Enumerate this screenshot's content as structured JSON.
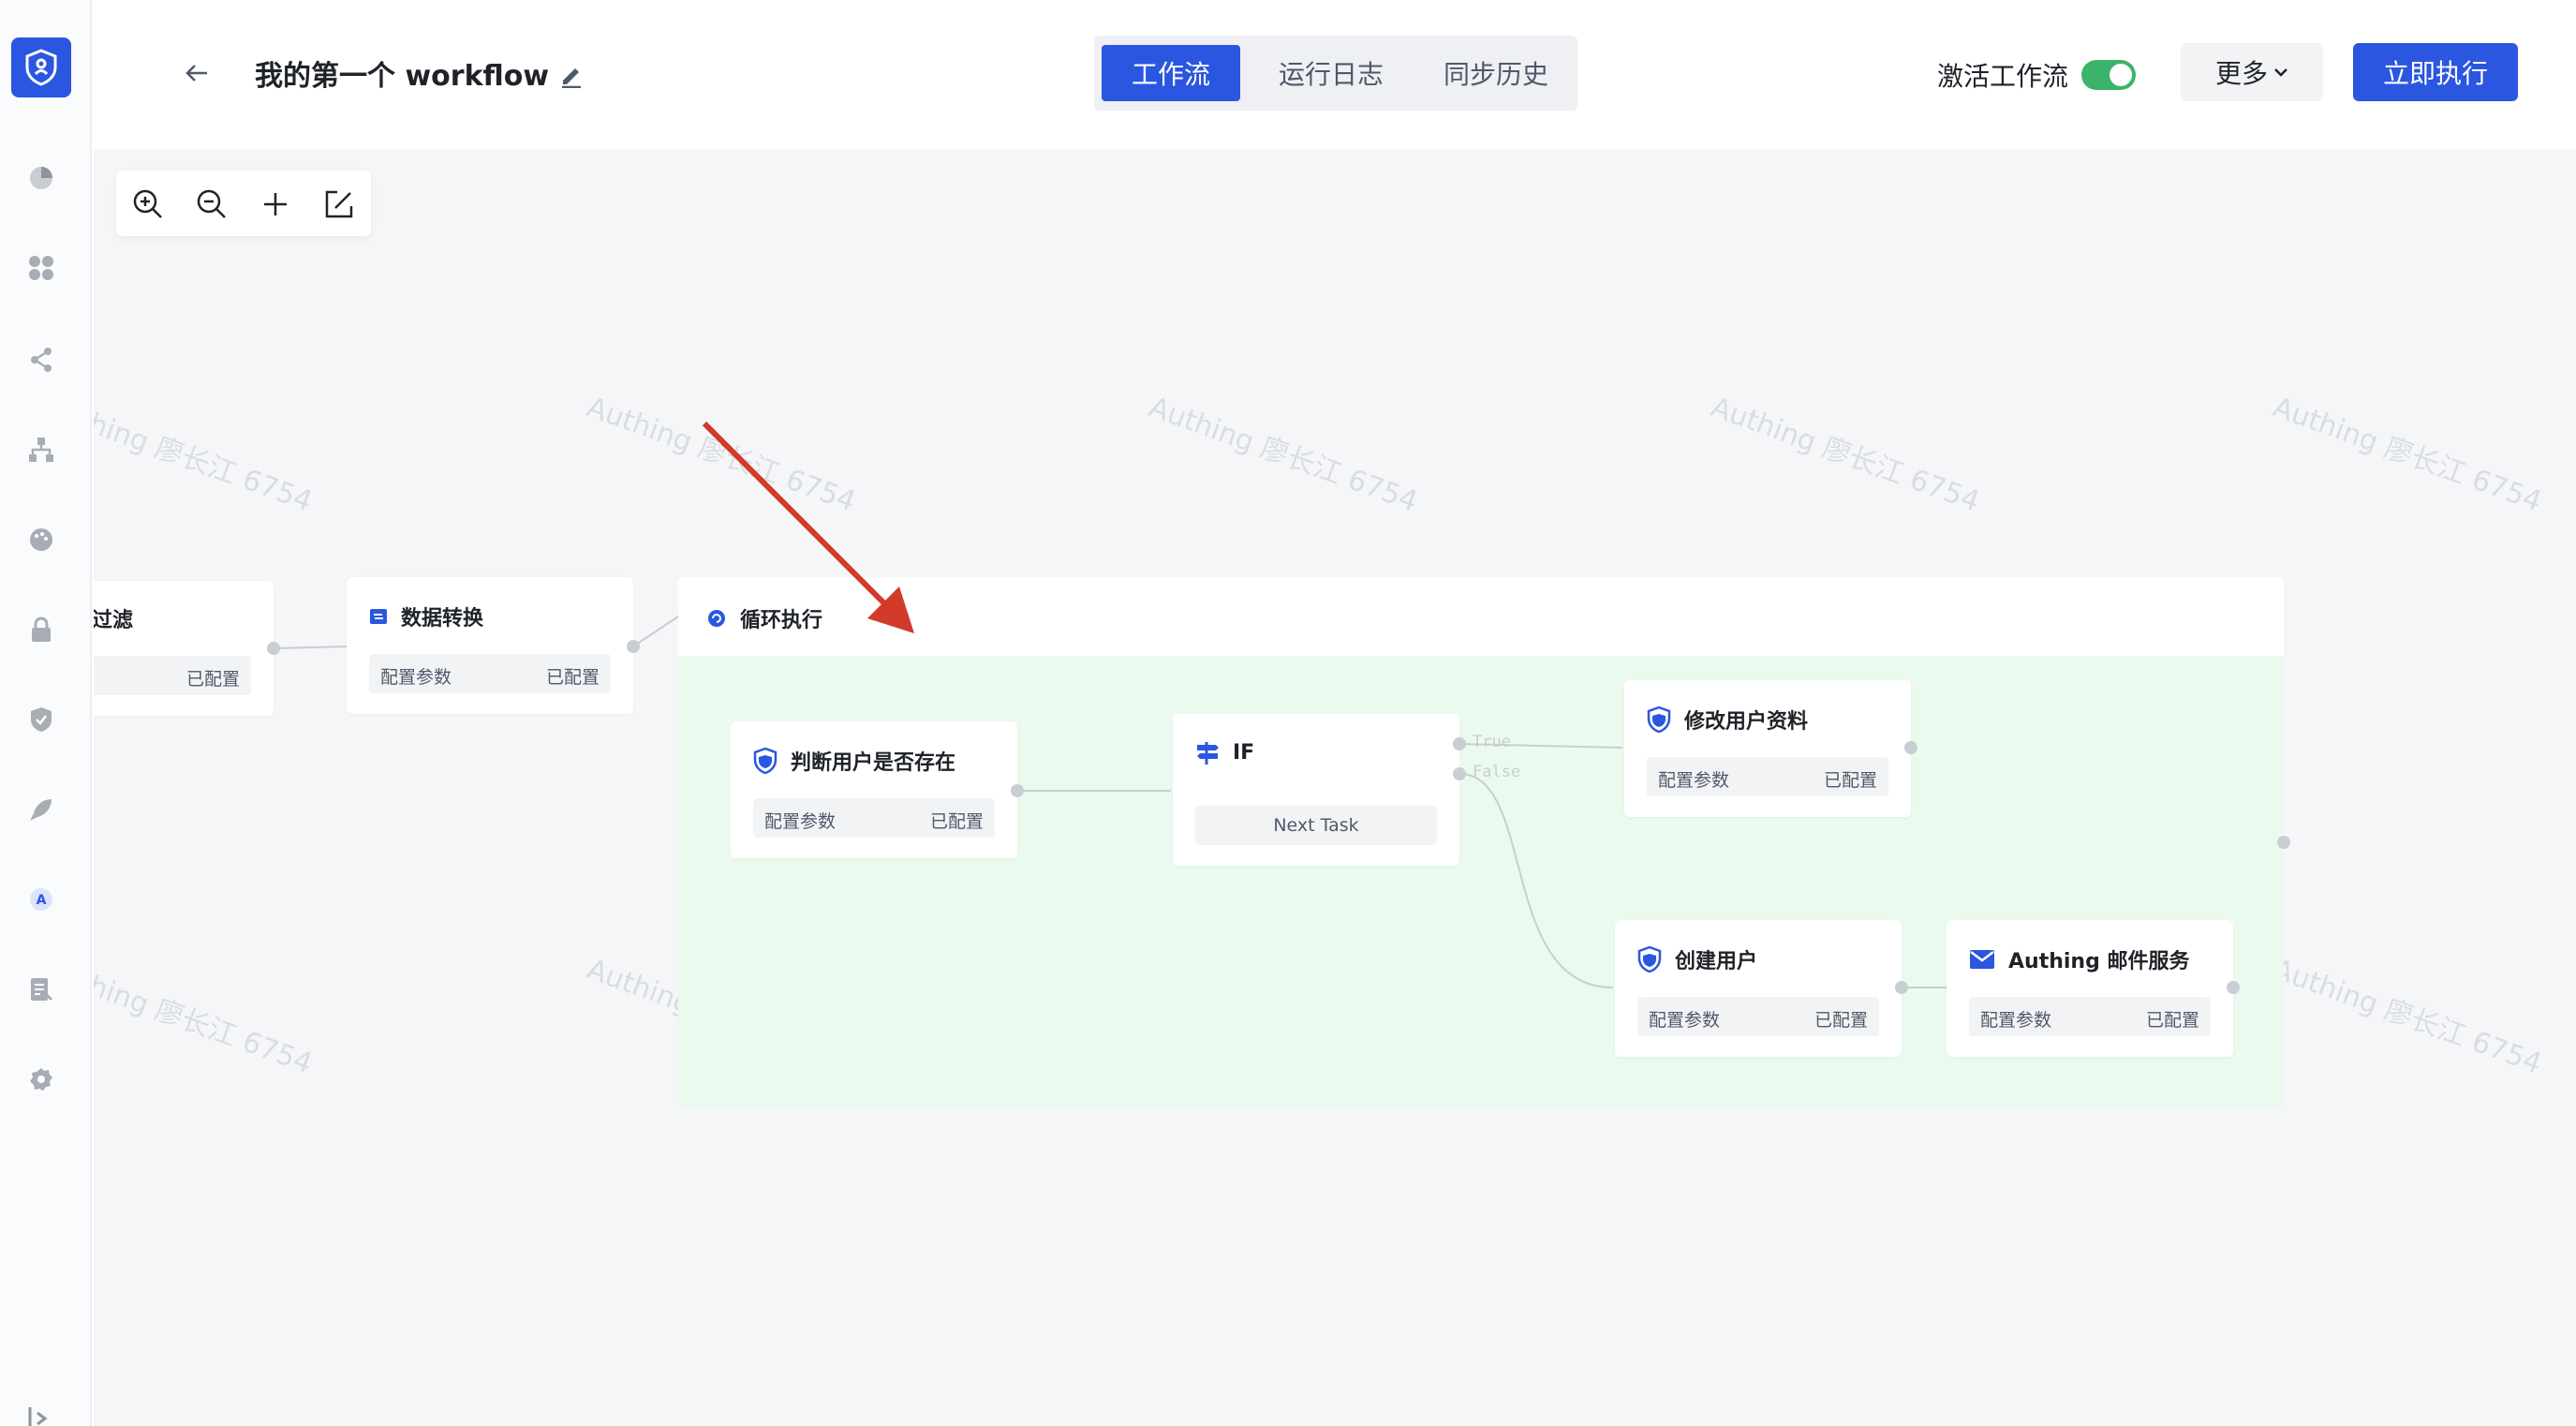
{
  "header": {
    "title": "我的第一个 workflow",
    "tabs": [
      "工作流",
      "运行日志",
      "同步历史"
    ],
    "active_tab": "工作流",
    "activate_label": "激活工作流",
    "activate_on": true,
    "more_label": "更多",
    "run_label": "立即执行"
  },
  "sidebar": {
    "icons": [
      "shield-logo-icon",
      "pie-chart-icon",
      "apps-icon",
      "share-icon",
      "org-tree-icon",
      "palette-icon",
      "lock-icon",
      "shield-check-icon",
      "rocket-icon",
      "a-letter-icon",
      "document-icon",
      "settings-icon",
      "collapse-icon"
    ]
  },
  "canvas": {
    "watermark": "Authing 廖长江 6754",
    "zoom_tools": [
      "zoom-in-icon",
      "zoom-out-icon",
      "add-icon",
      "edit-box-icon"
    ],
    "nodes": {
      "filter": {
        "title": "过滤",
        "status": "已配置"
      },
      "transform": {
        "title": "数据转换",
        "params": "配置参数",
        "status": "已配置"
      },
      "loop": {
        "title": "循环执行"
      },
      "check_user": {
        "title": "判断用户是否存在",
        "params": "配置参数",
        "status": "已配置"
      },
      "if": {
        "title": "IF",
        "body": "Next Task",
        "true_label": "True",
        "false_label": "False"
      },
      "update_user": {
        "title": "修改用户资料",
        "params": "配置参数",
        "status": "已配置"
      },
      "create_user": {
        "title": "创建用户",
        "params": "配置参数",
        "status": "已配置"
      },
      "email": {
        "title": "Authing 邮件服务",
        "params": "配置参数",
        "status": "已配置"
      }
    }
  },
  "colors": {
    "primary": "#2b56e0",
    "toggle_on": "#3bb36a",
    "loop_bg": "#ebfaee",
    "annotation_arrow": "#d23a2a"
  }
}
